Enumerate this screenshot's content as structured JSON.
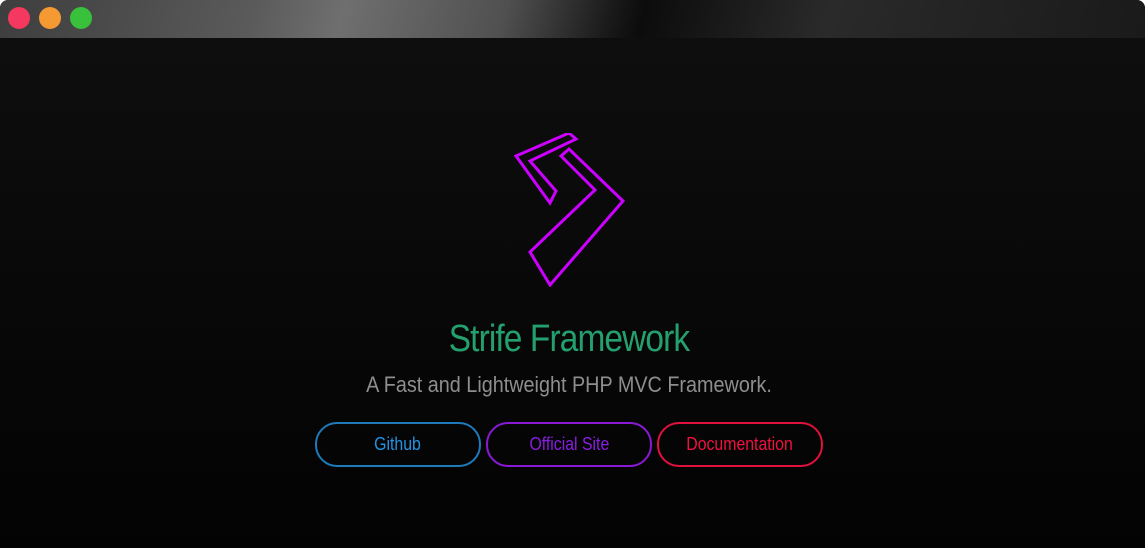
{
  "window": {
    "controls": [
      {
        "name": "close",
        "color": "#f4385f"
      },
      {
        "name": "minimize",
        "color": "#f59a32"
      },
      {
        "name": "maximize",
        "color": "#39c13b"
      }
    ]
  },
  "hero": {
    "logo_icon": "strife-logo-icon",
    "logo_color": "#cc00ff",
    "title": "Strife Framework",
    "title_color": "#24a06f",
    "subtitle": "A Fast and Lightweight PHP MVC Framework."
  },
  "buttons": {
    "github": {
      "label": "Github",
      "color": "#2293e4"
    },
    "site": {
      "label": "Official Site",
      "color": "#8a1de2"
    },
    "docs": {
      "label": "Documentation",
      "color": "#f0113f"
    }
  }
}
